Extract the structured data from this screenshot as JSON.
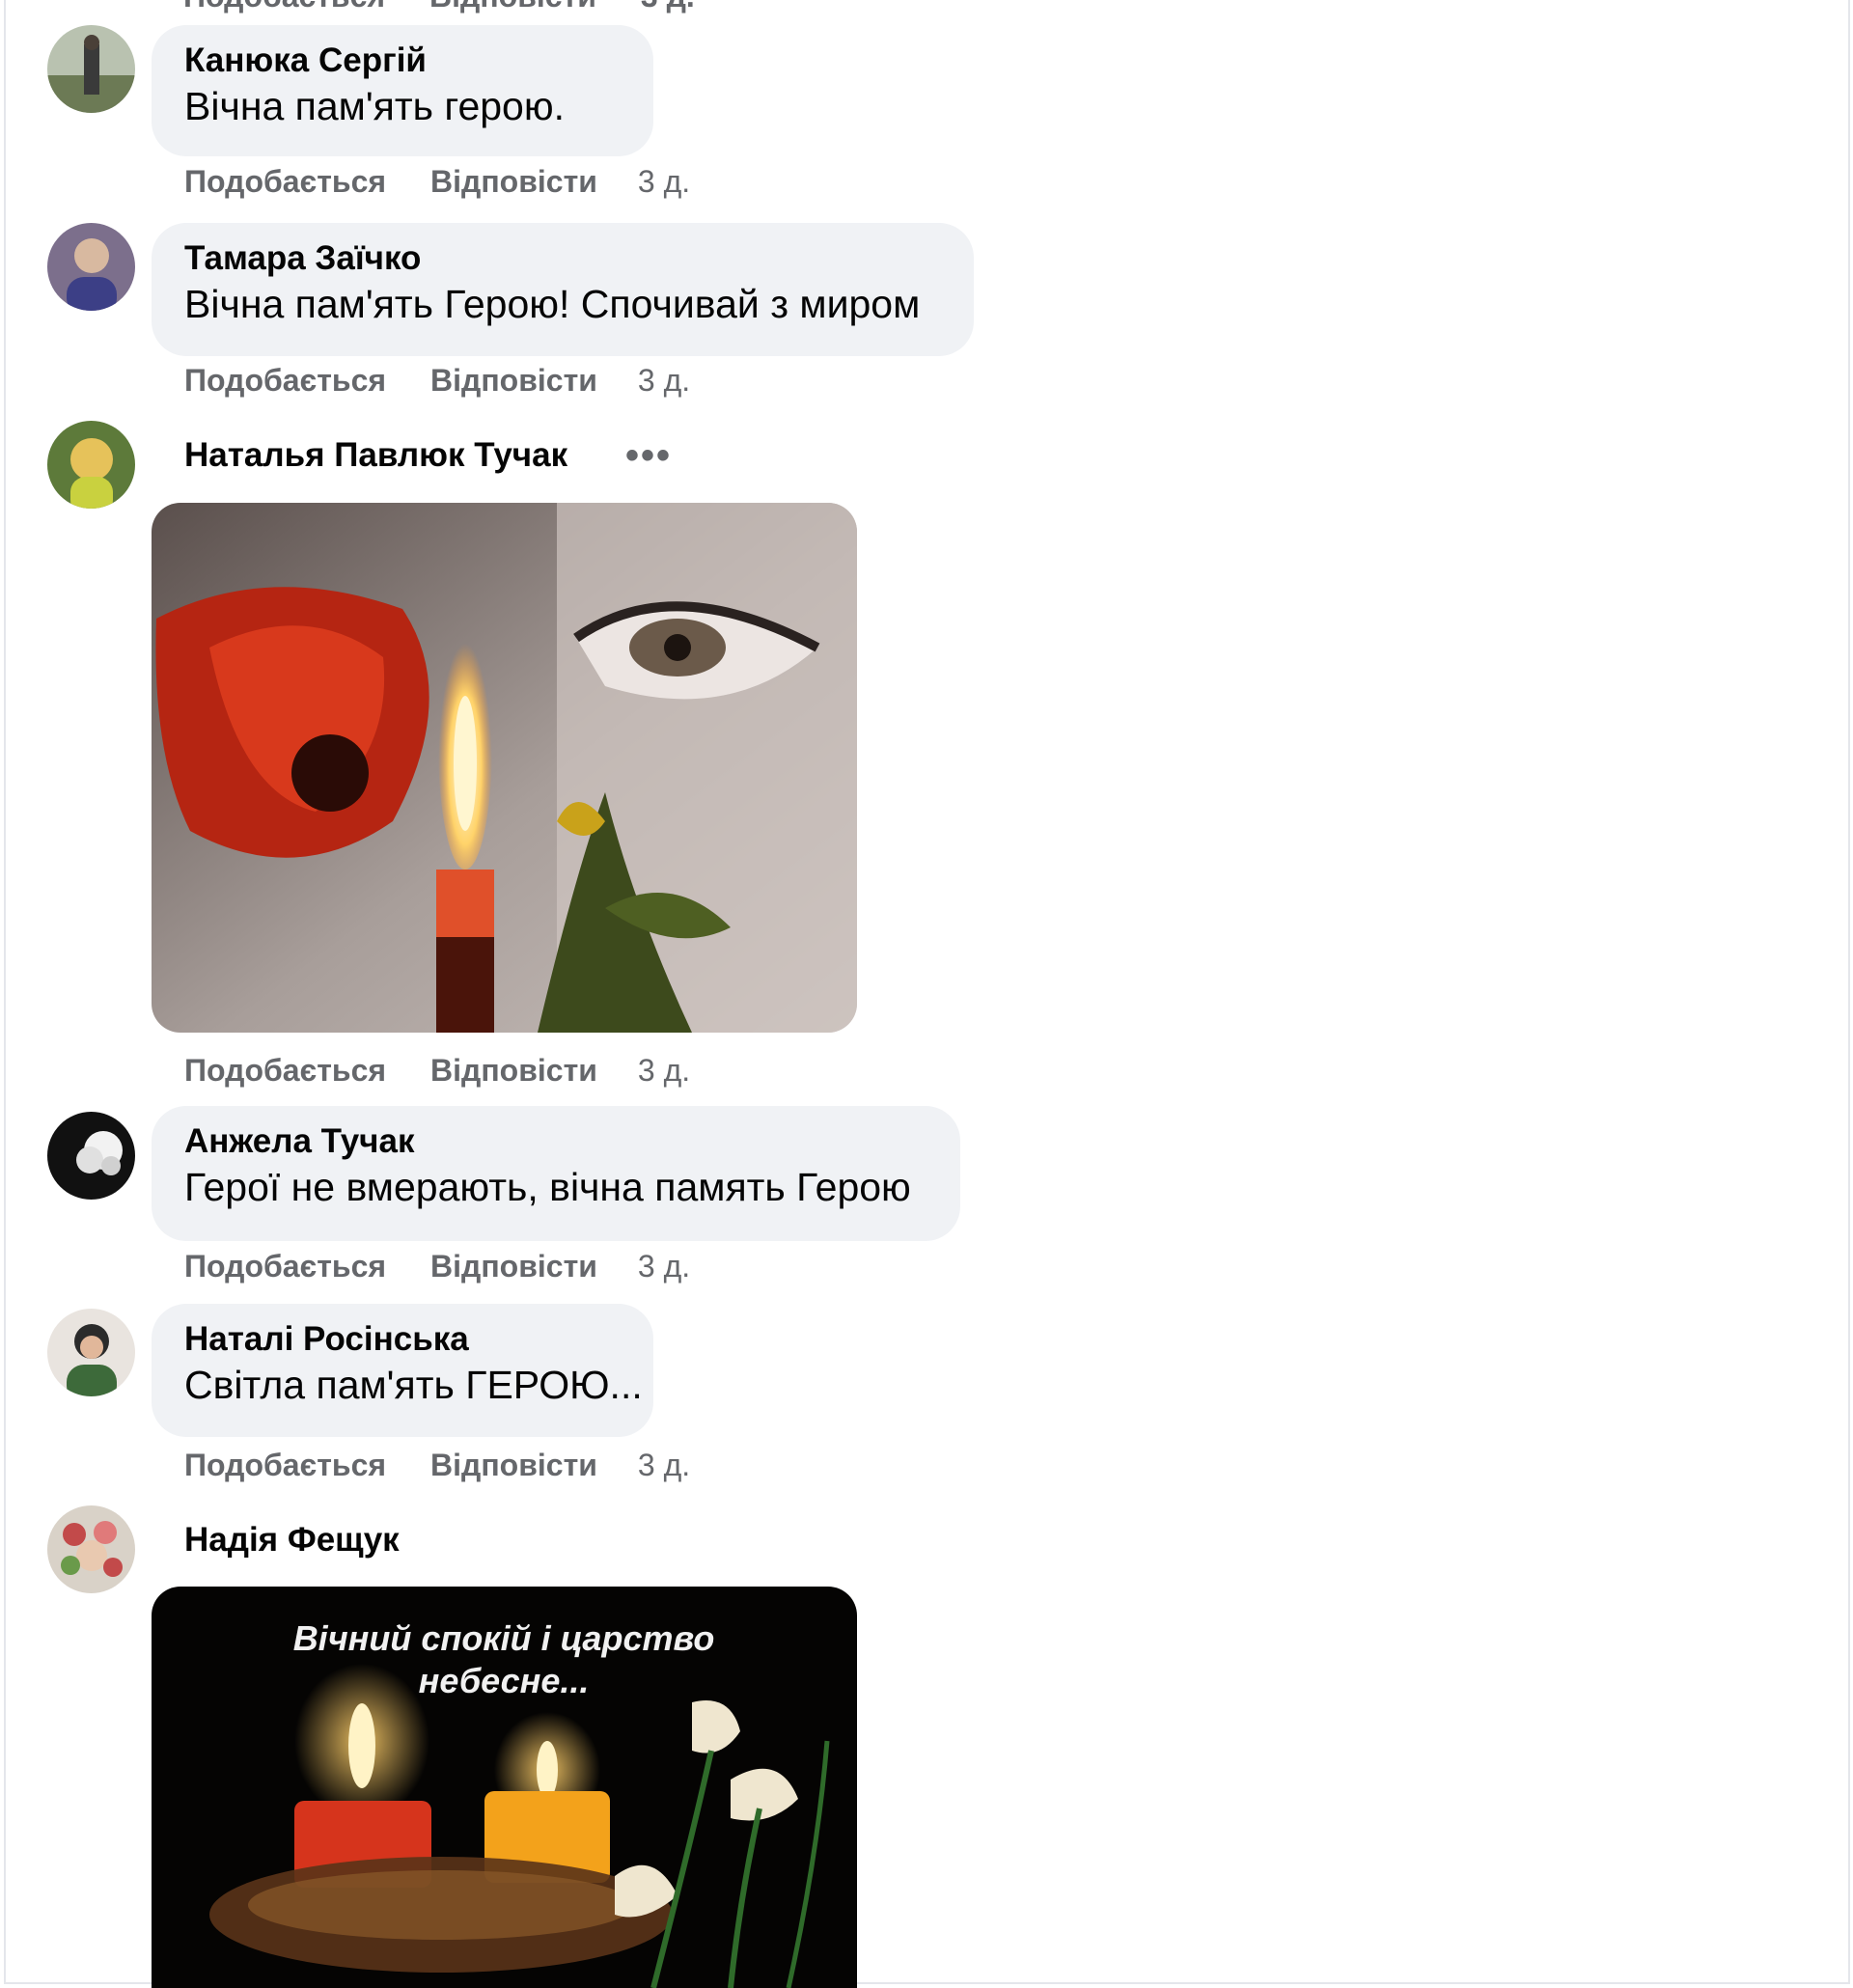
{
  "actions": {
    "like": "Подобається",
    "reply": "Відповісти"
  },
  "comments": [
    {
      "author": "Канюка Сергій",
      "text": "Вічна пам'ять герою.",
      "time": "3 д."
    },
    {
      "author": "Тамара Заїчко",
      "text": "Вічна пам'ять Герою! Спочивай з миром",
      "time": "3 д."
    },
    {
      "author": "Наталья Павлюк Тучак",
      "text": "",
      "time": "3 д.",
      "more_icon": "more-horizontal-icon",
      "image": "poppy, candle and crying eye memorial picture"
    },
    {
      "author": "Анжела Тучак",
      "text": "Герої не вмерають, вічна память Герою",
      "time": "3 д."
    },
    {
      "author": "Наталі Росінська",
      "text": "Світла пам'ять ГЕРОЮ...",
      "time": "3 д."
    },
    {
      "author": "Надія Фещук",
      "text": "",
      "image_caption": "Вічний спокій і царство небесне..."
    }
  ],
  "colors": {
    "bubble": "#f0f2f5",
    "secondary_text": "#65676b",
    "text": "#050505"
  }
}
